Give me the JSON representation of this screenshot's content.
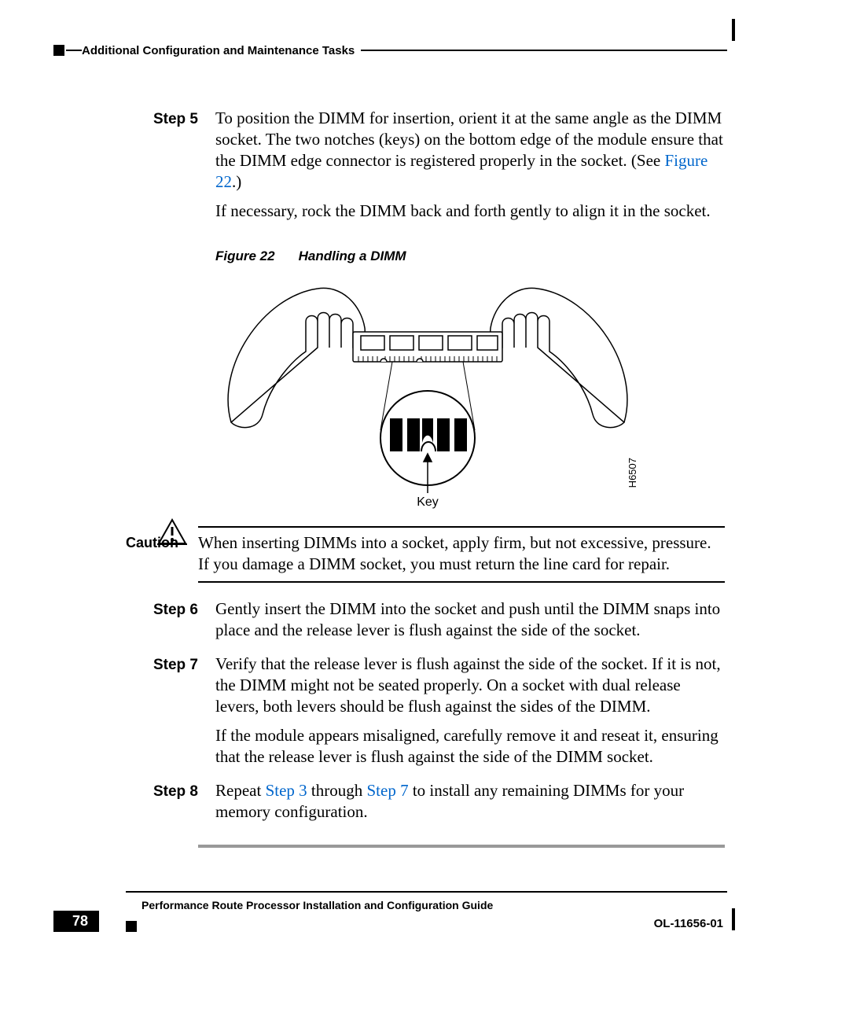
{
  "header": {
    "running_title": "Additional Configuration and Maintenance Tasks"
  },
  "steps": {
    "s5": {
      "label": "Step 5",
      "para1_before_link": "To position the DIMM for insertion, orient it at the same angle as the DIMM socket. The two notches (keys) on the bottom edge of the module ensure that the DIMM edge connector is registered properly in the socket. (See ",
      "para1_link": "Figure 22",
      "para1_after_link": ".)",
      "para2": "If necessary, rock the DIMM back and forth gently to align it in the socket."
    },
    "s6": {
      "label": "Step 6",
      "para1": "Gently insert the DIMM into the socket and push until the DIMM snaps into place and the release lever is flush against the side of the socket."
    },
    "s7": {
      "label": "Step 7",
      "para1": "Verify that the release lever is flush against the side of the socket. If it is not, the DIMM might not be seated properly. On a socket with dual release levers, both levers should be flush against the sides of the DIMM.",
      "para2": "If the module appears misaligned, carefully remove it and reseat it, ensuring that the release lever is flush against the side of the DIMM socket."
    },
    "s8": {
      "label": "Step 8",
      "para1_a": "Repeat ",
      "para1_link1": "Step 3",
      "para1_b": " through ",
      "para1_link2": "Step 7",
      "para1_c": " to install any remaining DIMMs for your memory configuration."
    }
  },
  "figure": {
    "num": "Figure 22",
    "title": "Handling a DIMM",
    "key_label": "Key",
    "art_id": "H6507"
  },
  "caution": {
    "label": "Caution",
    "text": "When inserting DIMMs into a socket, apply firm, but not excessive, pressure. If you damage a DIMM socket, you must return the line card for repair."
  },
  "footer": {
    "book_title": "Performance Route Processor Installation and Configuration Guide",
    "page_num": "78",
    "doc_id": "OL-11656-01"
  }
}
